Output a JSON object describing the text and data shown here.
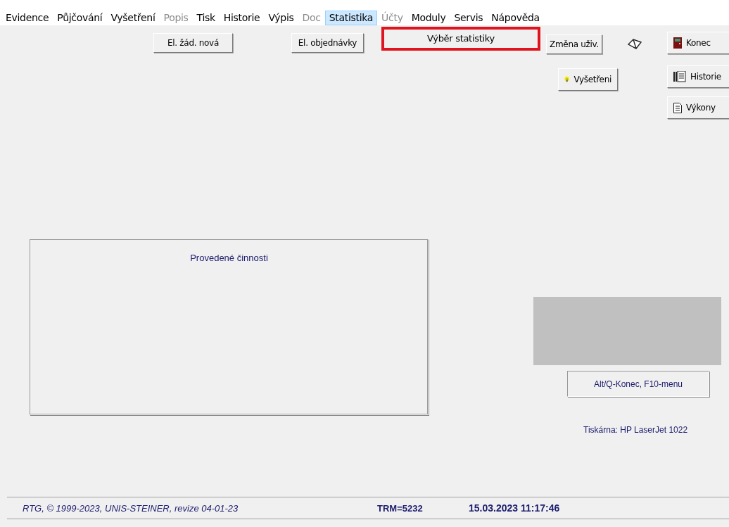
{
  "menu": [
    {
      "label": "Evidence",
      "disabled": false,
      "selected": false
    },
    {
      "label": "Půjčování",
      "disabled": false,
      "selected": false
    },
    {
      "label": "Vyšetření",
      "disabled": false,
      "selected": false
    },
    {
      "label": "Popis",
      "disabled": true,
      "selected": false
    },
    {
      "label": "Tisk",
      "disabled": false,
      "selected": false
    },
    {
      "label": "Historie",
      "disabled": false,
      "selected": false
    },
    {
      "label": "Výpis",
      "disabled": false,
      "selected": false
    },
    {
      "label": "Doc",
      "disabled": true,
      "selected": false
    },
    {
      "label": "Statistika",
      "disabled": false,
      "selected": true
    },
    {
      "label": "Účty",
      "disabled": true,
      "selected": false
    },
    {
      "label": "Moduly",
      "disabled": false,
      "selected": false
    },
    {
      "label": "Servis",
      "disabled": false,
      "selected": false
    },
    {
      "label": "Nápověda",
      "disabled": false,
      "selected": false
    }
  ],
  "dropdown": {
    "items": [
      {
        "label": "Výběr statistiky",
        "highlighted": true
      }
    ]
  },
  "buttons": [
    {
      "label": "El. žád. nová",
      "kind": "plain"
    },
    {
      "label": "El. objednávky",
      "kind": "plain"
    },
    {
      "label": "Změna uživ.",
      "kind": "plain"
    },
    {
      "label": "Konec",
      "kind": "door"
    },
    {
      "label": "Vyšetřeni",
      "kind": "bulb"
    },
    {
      "label": "Historie",
      "kind": "pages"
    },
    {
      "label": "Výkony",
      "kind": "page"
    }
  ],
  "activity_panel": {
    "title": "Provedené činnosti"
  },
  "hint": "Alt/Q-Konec, F10-menu",
  "printer": "Tiskárna: HP LaserJet 1022",
  "status_bar": {
    "copyright": "RTG, © 1999-2023, UNIS-STEINER, revize 04-01-23",
    "terminal": "TRM=5232",
    "datetime": "15.03.2023 11:17:46"
  }
}
